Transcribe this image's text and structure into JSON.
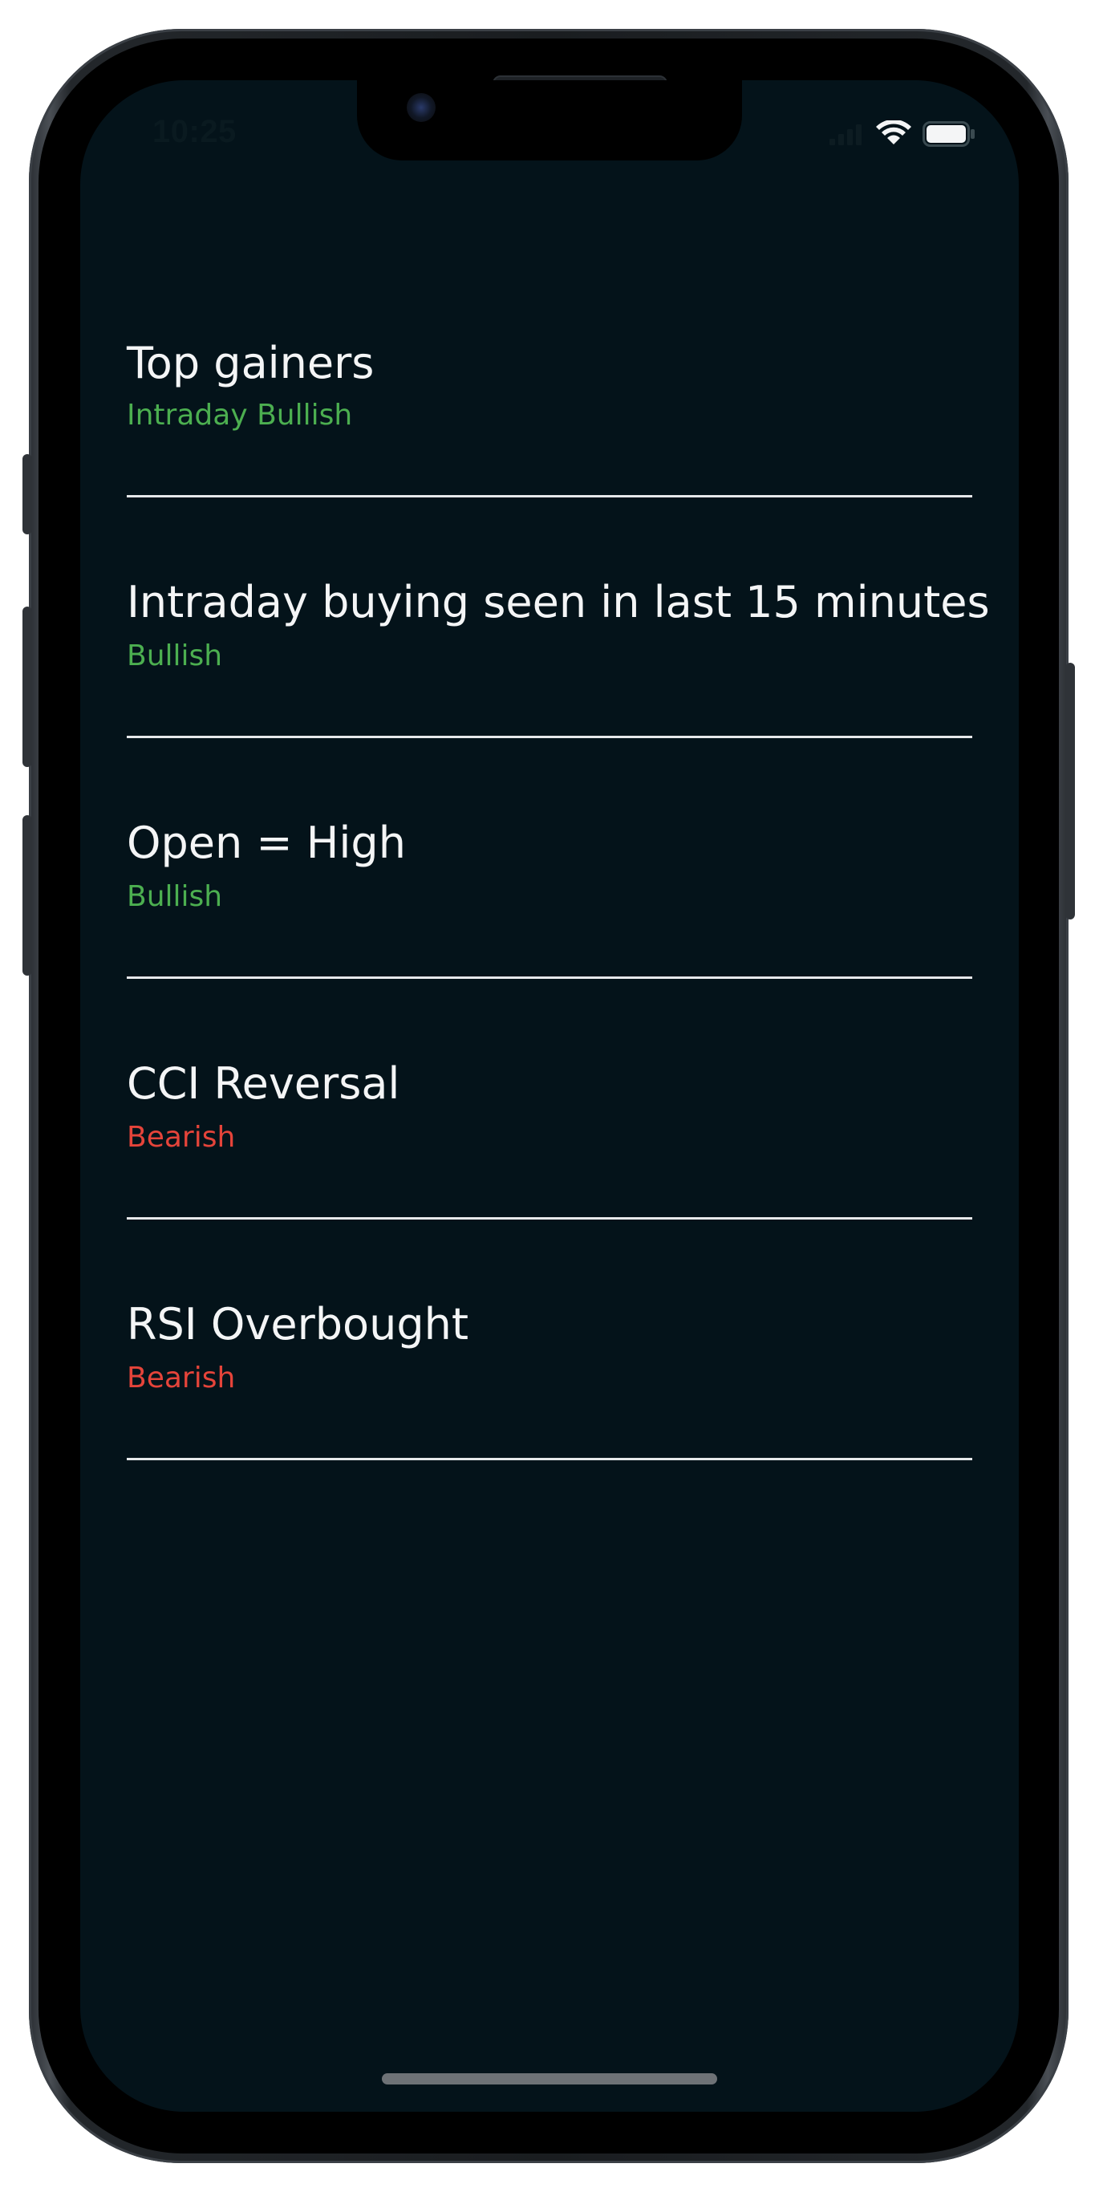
{
  "status_bar": {
    "time": "10:25",
    "icons": [
      "signal-icon",
      "wifi-icon",
      "battery-icon"
    ]
  },
  "colors": {
    "background": "#04131a",
    "title": "#f4f5f6",
    "bullish": "#4caf50",
    "bearish": "#e5443a",
    "divider": "#e6e8ea"
  },
  "screeners": [
    {
      "title": "Top gainers",
      "sentiment": "Intraday Bullish",
      "tone": "bullish"
    },
    {
      "title": "Intraday buying seen in last 15 minutes",
      "sentiment": "Bullish",
      "tone": "bullish"
    },
    {
      "title": "Open = High",
      "sentiment": "Bullish",
      "tone": "bullish"
    },
    {
      "title": "CCI Reversal",
      "sentiment": "Bearish",
      "tone": "bearish"
    },
    {
      "title": "RSI Overbought",
      "sentiment": "Bearish",
      "tone": "bearish"
    }
  ]
}
